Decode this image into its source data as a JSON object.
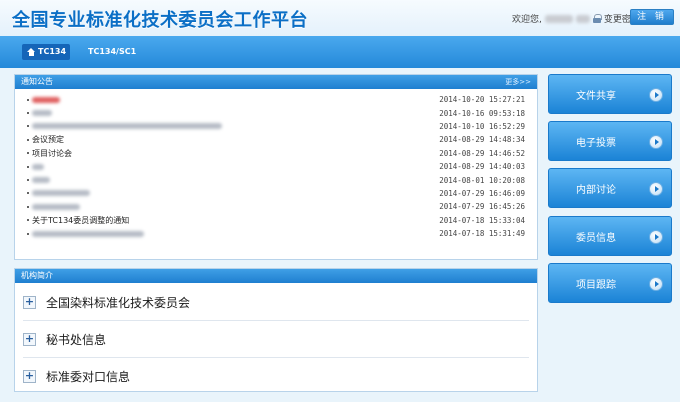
{
  "header": {
    "title": "全国专业标准化技术委员会工作平台",
    "welcome": "欢迎您,",
    "change_password": "变更密码",
    "logout": "注 销"
  },
  "nav": {
    "tabs": [
      {
        "label": "TC134",
        "icon": "home-icon",
        "active": true
      },
      {
        "label": "TC134/SC1",
        "active": false
      }
    ]
  },
  "notices": {
    "heading": "通知公告",
    "more": "更多>>",
    "items": [
      {
        "title": "",
        "obscured": true,
        "date": "2014-10-20 15:27:21"
      },
      {
        "title": "",
        "obscured": true,
        "date": "2014-10-16 09:53:18"
      },
      {
        "title": "",
        "obscured": true,
        "date": "2014-10-10 16:52:29"
      },
      {
        "title": "会议预定",
        "obscured": false,
        "date": "2014-08-29 14:48:34"
      },
      {
        "title": "项目讨论会",
        "obscured": false,
        "date": "2014-08-29 14:46:52"
      },
      {
        "title": "",
        "obscured": true,
        "date": "2014-08-29 14:40:03"
      },
      {
        "title": "",
        "obscured": true,
        "date": "2014-08-01 10:20:08"
      },
      {
        "title": "",
        "obscured": true,
        "date": "2014-07-29 16:46:09"
      },
      {
        "title": "",
        "obscured": true,
        "date": "2014-07-29 16:45:26"
      },
      {
        "title": "关于TC134委员调整的通知",
        "obscured": false,
        "date": "2014-07-18 15:33:04"
      },
      {
        "title": "",
        "obscured": true,
        "date": "2014-07-18 15:31:49"
      }
    ]
  },
  "org": {
    "heading": "机构简介",
    "items": [
      {
        "label": "全国染料标准化技术委员会"
      },
      {
        "label": "秘书处信息"
      },
      {
        "label": "标准委对口信息"
      }
    ]
  },
  "side_buttons": [
    {
      "label": "文件共享"
    },
    {
      "label": "电子投票"
    },
    {
      "label": "内部讨论"
    },
    {
      "label": "委员信息"
    },
    {
      "label": "项目跟踪"
    }
  ],
  "colors": {
    "brand_blue": "#0b6fc6",
    "nav_blue": "#2489d9",
    "background": "#e9f4fb"
  }
}
